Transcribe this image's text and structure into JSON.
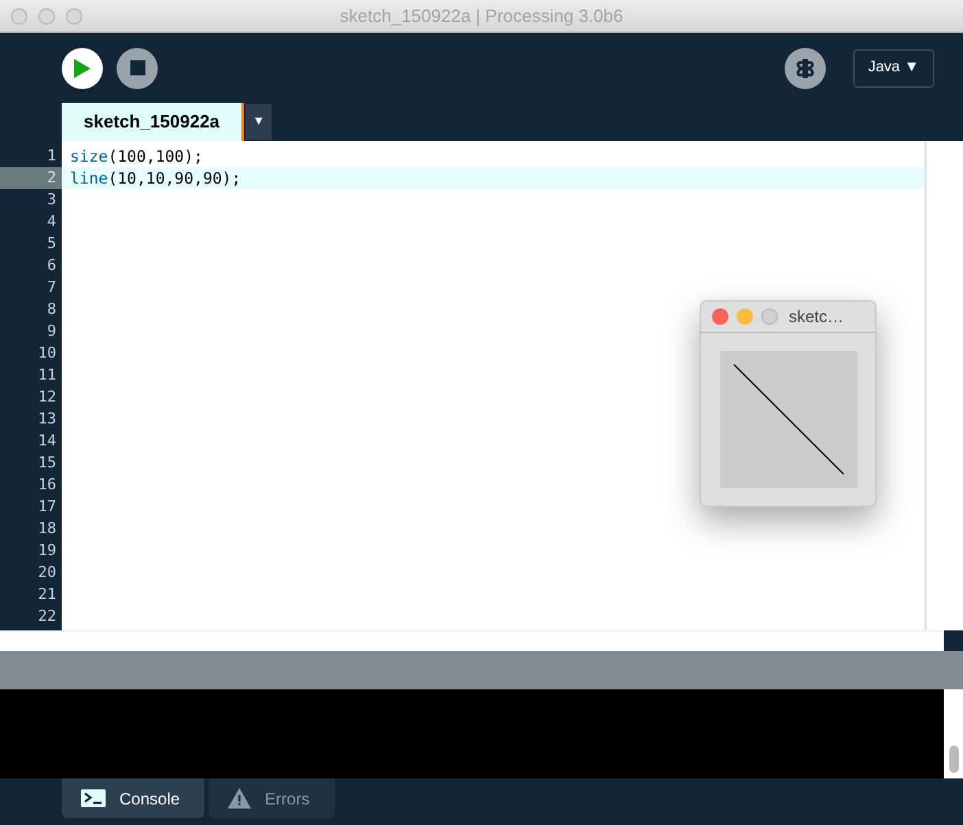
{
  "window": {
    "title": "sketch_150922a | Processing 3.0b6"
  },
  "toolbar": {
    "buttons": [
      {
        "kind": "run"
      },
      {
        "kind": "stop"
      }
    ],
    "debug": {
      "kind": "debug"
    },
    "mode": {
      "label": "Java",
      "caret": "▼"
    }
  },
  "tabs": [
    {
      "label": "sketch_150922a",
      "selected": true
    }
  ],
  "tab_menu": "▼",
  "editor": {
    "lines": [
      {
        "number": "1",
        "current": false,
        "tokens": [
          {
            "kind": "function",
            "text": "size"
          },
          {
            "kind": "plain",
            "text": "(100,100);"
          }
        ]
      },
      {
        "number": "2",
        "current": true,
        "tokens": [
          {
            "kind": "function",
            "text": "line"
          },
          {
            "kind": "plain",
            "text": "(10,10,90,90);"
          }
        ]
      },
      {
        "number": "3",
        "current": false
      },
      {
        "number": "4",
        "current": false
      },
      {
        "number": "5",
        "current": false
      },
      {
        "number": "6",
        "current": false
      },
      {
        "number": "7",
        "current": false
      },
      {
        "number": "8",
        "current": false
      },
      {
        "number": "9",
        "current": false
      },
      {
        "number": "10",
        "current": false
      },
      {
        "number": "11",
        "current": false
      },
      {
        "number": "12",
        "current": false
      },
      {
        "number": "13",
        "current": false
      },
      {
        "number": "14",
        "current": false
      },
      {
        "number": "15",
        "current": false
      },
      {
        "number": "16",
        "current": false
      },
      {
        "number": "17",
        "current": false
      },
      {
        "number": "18",
        "current": false
      },
      {
        "number": "19",
        "current": false
      },
      {
        "number": "20",
        "current": false
      },
      {
        "number": "21",
        "current": false
      },
      {
        "number": "22",
        "current": false
      }
    ]
  },
  "sketch_window": {
    "title": "sketc…"
  },
  "console_tabs": [
    {
      "label": "Console",
      "kind": "console",
      "selected": true
    },
    {
      "label": "Errors",
      "kind": "errors",
      "selected": false
    }
  ]
}
